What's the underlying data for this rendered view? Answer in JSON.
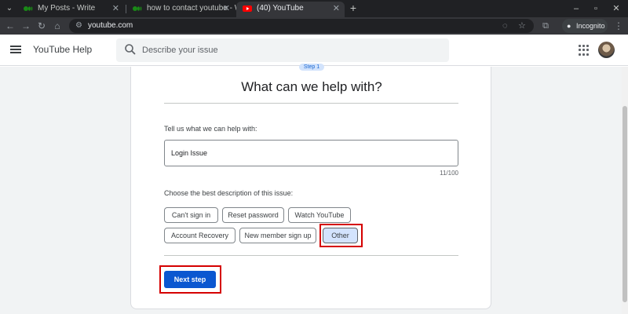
{
  "browser": {
    "tabs": [
      {
        "title": "My Posts - Write",
        "active": false
      },
      {
        "title": "how to contact youtube - Write",
        "active": false
      },
      {
        "title": "(40) YouTube",
        "active": true
      }
    ],
    "url": "youtube.com",
    "incognito_label": "Incognito",
    "accent_colors": {
      "medium": "#1a8917",
      "youtube": "#ff0000"
    }
  },
  "header": {
    "title": "YouTube Help",
    "search_placeholder": "Describe your issue"
  },
  "form": {
    "step_label": "Step 1",
    "title": "What can we help with?",
    "issue_label": "Tell us what we can help with:",
    "issue_value": "Login Issue",
    "char_count": "11/100",
    "description_label": "Choose the best description of this issue:",
    "options": [
      "Can't sign in",
      "Reset password",
      "Watch YouTube",
      "Account Recovery",
      "New member sign up",
      "Other"
    ],
    "selected_option": "Other",
    "next_label": "Next step",
    "primary_color": "#0b57d0",
    "highlight_color": "#d50000"
  }
}
